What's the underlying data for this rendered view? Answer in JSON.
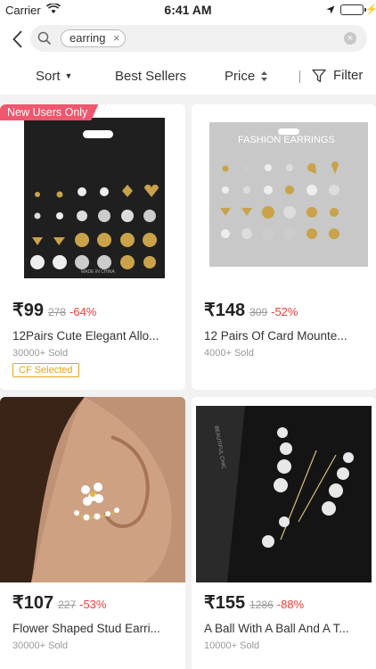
{
  "status_bar": {
    "carrier": "Carrier",
    "time": "6:41 AM"
  },
  "search": {
    "query_chip": "earring",
    "chip_close": "×",
    "clear": "×"
  },
  "sort_bar": {
    "sort_label": "Sort",
    "best_sellers_label": "Best Sellers",
    "price_label": "Price",
    "filter_label": "Filter"
  },
  "products": [
    {
      "tag": "New Users Only",
      "price": "₹99",
      "original_price": "278",
      "discount": "-64%",
      "title": "12Pairs Cute Elegant Allo...",
      "sold": "30000+ Sold",
      "badge": "CF Selected",
      "card_label": "MADE IN CHINA"
    },
    {
      "price": "₹148",
      "original_price": "309",
      "discount": "-52%",
      "title": "12 Pairs Of Card Mounte...",
      "sold": "4000+ Sold",
      "card_label": "FASHION EARRINGS"
    },
    {
      "price": "₹107",
      "original_price": "227",
      "discount": "-53%",
      "title": "Flower Shaped Stud Earri...",
      "sold": "30000+ Sold"
    },
    {
      "price": "₹155",
      "original_price": "1286",
      "discount": "-88%",
      "title": "A Ball With A Ball And A T...",
      "sold": "10000+ Sold",
      "box_label": "BEAUTIFUL CHIC"
    }
  ],
  "colors": {
    "discount": "#e8413b",
    "tag": "#f0566e",
    "badge": "#e7a416",
    "battery": "#3fbf3f"
  }
}
